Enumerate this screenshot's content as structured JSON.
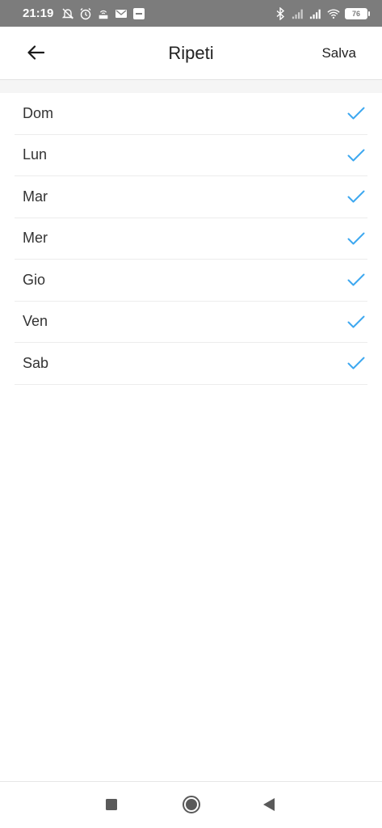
{
  "status_bar": {
    "time": "21:19",
    "battery": "76"
  },
  "header": {
    "title": "Ripeti",
    "save_label": "Salva"
  },
  "days": [
    {
      "label": "Dom",
      "checked": true
    },
    {
      "label": "Lun",
      "checked": true
    },
    {
      "label": "Mar",
      "checked": true
    },
    {
      "label": "Mer",
      "checked": true
    },
    {
      "label": "Gio",
      "checked": true
    },
    {
      "label": "Ven",
      "checked": true
    },
    {
      "label": "Sab",
      "checked": true
    }
  ],
  "colors": {
    "check": "#3ea8f0",
    "status_bar": "#7c7c7c"
  },
  "icons": {
    "back": "arrow-left-icon",
    "check": "check-icon",
    "nav_recents": "square-icon",
    "nav_home": "circle-icon",
    "nav_back": "triangle-back-icon"
  }
}
